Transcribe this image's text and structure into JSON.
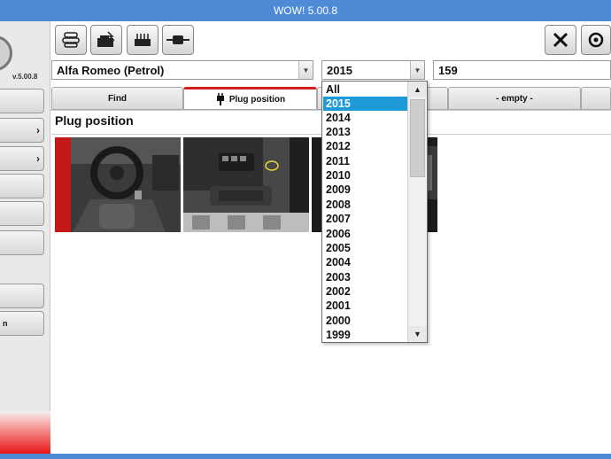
{
  "window": {
    "title": "WOW! 5.00.8"
  },
  "sidebar": {
    "version": "v.5.00.8",
    "buttons": [
      {
        "label": "",
        "chevron": false
      },
      {
        "label": "",
        "chevron": true
      },
      {
        "label": "",
        "chevron": true
      },
      {
        "label": "",
        "chevron": false
      },
      {
        "label": "",
        "chevron": false
      },
      {
        "label": "",
        "chevron": false
      },
      {
        "label": "",
        "chevron": false
      },
      {
        "label": "n",
        "chevron": false
      }
    ],
    "chevron_glyph": "›"
  },
  "toolbar": {
    "left_icons": [
      "car-list-icon",
      "engine-icon",
      "ecu-module-icon",
      "connector-cable-icon"
    ],
    "right_icons": [
      "tools-icon",
      "refresh-icon"
    ]
  },
  "selectors": {
    "make": "Alfa Romeo (Petrol)",
    "year": "2015",
    "model": "159",
    "arrow_glyph": "▼"
  },
  "tabs": [
    {
      "label": "Find",
      "active": false
    },
    {
      "label": "Plug position",
      "active": true,
      "icon": "plug-icon"
    },
    {
      "label": "",
      "active": false
    },
    {
      "label": "-  empty  -",
      "active": false
    },
    {
      "label": "",
      "active": false
    }
  ],
  "content": {
    "section_title": "Plug position",
    "photos": [
      "car-interior-photo",
      "dashboard-connector-photo",
      "footwell-photo"
    ]
  },
  "year_dropdown": {
    "options": [
      "All",
      "2015",
      "2014",
      "2013",
      "2012",
      "2011",
      "2010",
      "2009",
      "2008",
      "2007",
      "2006",
      "2005",
      "2004",
      "2003",
      "2002",
      "2001",
      "2000",
      "1999"
    ],
    "selected": "2015",
    "scroll_up_glyph": "▲",
    "scroll_down_glyph": "▼"
  },
  "colors": {
    "titlebar": "#4f8ad6",
    "active_tab_accent": "#d21f1f",
    "selection": "#1e9ad8"
  }
}
